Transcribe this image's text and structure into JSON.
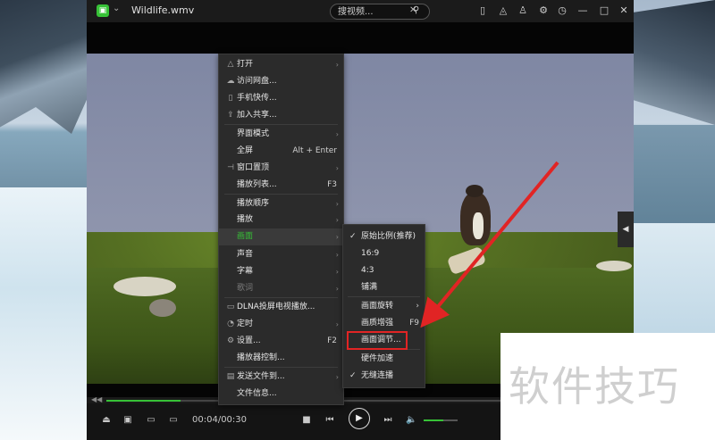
{
  "window": {
    "title": "Wildlife.wmv",
    "logo": "▣"
  },
  "search": {
    "placeholder": "搜视频..."
  },
  "player": {
    "time": "00:04/00:30",
    "progress_fraction": 0.14,
    "volume_fraction": 0.58
  },
  "menu": {
    "items": [
      {
        "label": "打开",
        "icon": "folder-icon",
        "glyph": "△",
        "submenu": true
      },
      {
        "label": "访问网盘...",
        "icon": "cloud-icon",
        "glyph": "☁"
      },
      {
        "label": "手机快传...",
        "icon": "phone-icon",
        "glyph": "▯"
      },
      {
        "label": "加入共享...",
        "icon": "share-icon",
        "glyph": "⇪"
      },
      {
        "label": "界面模式",
        "submenu": true
      },
      {
        "label": "全屏",
        "shortcut": "Alt + Enter"
      },
      {
        "label": "窗口置顶",
        "icon": "pin-icon",
        "glyph": "⊣",
        "submenu": true
      },
      {
        "label": "播放列表...",
        "shortcut": "F3"
      },
      {
        "label": "播放顺序",
        "submenu": true
      },
      {
        "label": "播放",
        "submenu": true
      },
      {
        "label": "画面",
        "submenu": true,
        "highlighted": true
      },
      {
        "label": "声音",
        "submenu": true
      },
      {
        "label": "字幕",
        "submenu": true
      },
      {
        "label": "歌词",
        "submenu": true,
        "disabled": true
      },
      {
        "label": "DLNA投屏电视播放...",
        "icon": "cast-icon",
        "glyph": "▭"
      },
      {
        "label": "定时",
        "icon": "timer-icon",
        "glyph": "◔",
        "submenu": true
      },
      {
        "label": "设置...",
        "icon": "gear-icon",
        "glyph": "⚙",
        "shortcut": "F2"
      },
      {
        "label": "播放器控制..."
      },
      {
        "label": "发送文件到...",
        "icon": "send-icon",
        "glyph": "▤",
        "submenu": true
      },
      {
        "label": "文件信息..."
      }
    ]
  },
  "submenu": {
    "items": [
      {
        "label": "原始比例(推荐)",
        "checked": true
      },
      {
        "label": "16:9"
      },
      {
        "label": "4:3"
      },
      {
        "label": "铺满"
      },
      {
        "label": "画面旋转",
        "submenu": true
      },
      {
        "label": "画质增强",
        "shortcut": "F9"
      },
      {
        "label": "画面调节...",
        "boxed": true
      },
      {
        "label": "硬件加速"
      },
      {
        "label": "无缝连播",
        "checked": true
      }
    ]
  },
  "watermark": {
    "text": "软件技巧"
  },
  "colors": {
    "accent": "#37c237",
    "callout": "#e12424",
    "menu_bg": "#2b2b2b"
  }
}
